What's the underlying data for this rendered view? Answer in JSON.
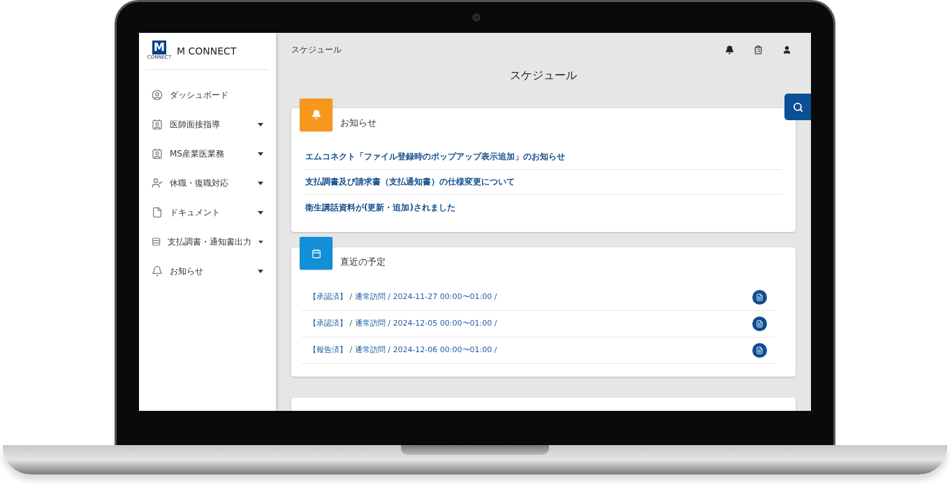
{
  "app": {
    "logo": {
      "mark": "M",
      "caption": "CONNECT"
    },
    "name": "M CONNECT"
  },
  "sidebar": {
    "items": [
      {
        "label": "ダッシュボード",
        "kind": "link"
      },
      {
        "label": "医師面接指導",
        "kind": "menu"
      },
      {
        "label": "MS産業医業務",
        "kind": "menu"
      },
      {
        "label": "休職・復職対応",
        "kind": "menu"
      },
      {
        "label": "ドキュメント",
        "kind": "menu"
      },
      {
        "label": "支払調書・通知書出力",
        "kind": "menu"
      },
      {
        "label": "お知らせ",
        "kind": "menu"
      }
    ]
  },
  "header": {
    "breadcrumb": "スケジュール",
    "title": "スケジュール"
  },
  "notices": {
    "title": "お知らせ",
    "links": [
      "エムコネクト「ファイル登録時のポップアップ表示追加」のお知らせ",
      "支払調書及び請求書（支払通知書）の仕様変更について",
      "衛生講話資料が(更新・追加)されました"
    ]
  },
  "schedule": {
    "title": "直近の予定",
    "rows": [
      {
        "text": "【承認済】 / 通常訪問 / 2024-11-27 00:00〜01:00 /"
      },
      {
        "text": "【承認済】 / 通常訪問 / 2024-12-05 00:00〜01:00 /"
      },
      {
        "text": "【報告済】 / 通常訪問 / 2024-12-06 00:00〜01:00 /"
      }
    ]
  }
}
